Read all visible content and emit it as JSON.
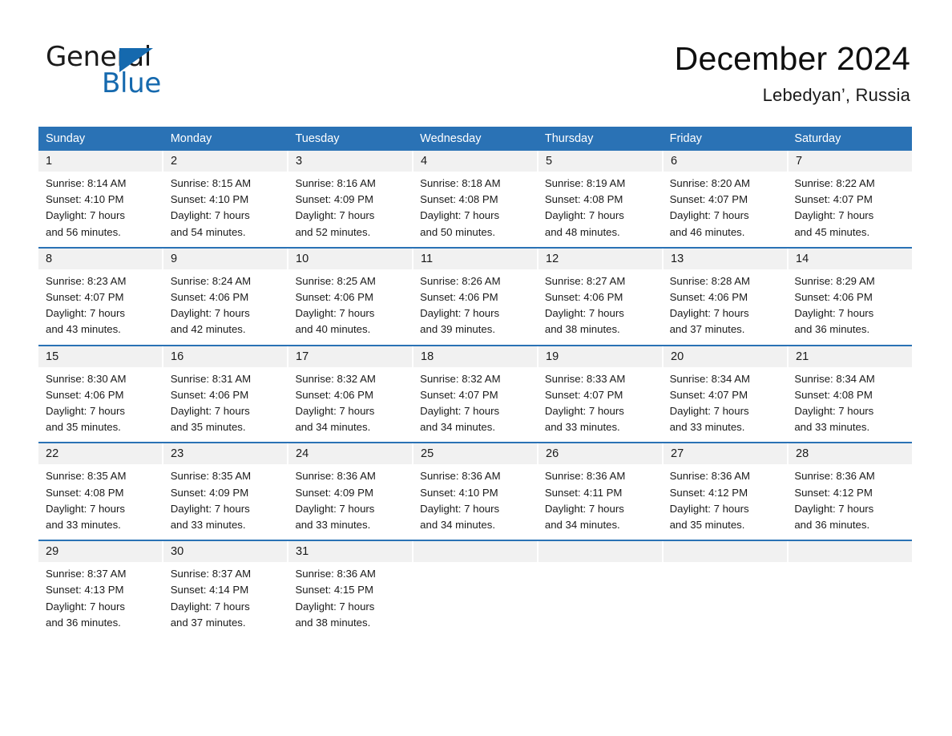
{
  "brand": {
    "name_part1": "General",
    "name_part2": "Blue",
    "triangle_color": "#1569ae"
  },
  "header": {
    "title": "December 2024",
    "subtitle": "Lebedyan’, Russia",
    "accent_color": "#2a72b5"
  },
  "weekdays": [
    "Sunday",
    "Monday",
    "Tuesday",
    "Wednesday",
    "Thursday",
    "Friday",
    "Saturday"
  ],
  "weeks": [
    {
      "days": [
        {
          "date": "1",
          "lines": [
            "Sunrise: 8:14 AM",
            "Sunset: 4:10 PM",
            "Daylight: 7 hours",
            "and 56 minutes."
          ]
        },
        {
          "date": "2",
          "lines": [
            "Sunrise: 8:15 AM",
            "Sunset: 4:10 PM",
            "Daylight: 7 hours",
            "and 54 minutes."
          ]
        },
        {
          "date": "3",
          "lines": [
            "Sunrise: 8:16 AM",
            "Sunset: 4:09 PM",
            "Daylight: 7 hours",
            "and 52 minutes."
          ]
        },
        {
          "date": "4",
          "lines": [
            "Sunrise: 8:18 AM",
            "Sunset: 4:08 PM",
            "Daylight: 7 hours",
            "and 50 minutes."
          ]
        },
        {
          "date": "5",
          "lines": [
            "Sunrise: 8:19 AM",
            "Sunset: 4:08 PM",
            "Daylight: 7 hours",
            "and 48 minutes."
          ]
        },
        {
          "date": "6",
          "lines": [
            "Sunrise: 8:20 AM",
            "Sunset: 4:07 PM",
            "Daylight: 7 hours",
            "and 46 minutes."
          ]
        },
        {
          "date": "7",
          "lines": [
            "Sunrise: 8:22 AM",
            "Sunset: 4:07 PM",
            "Daylight: 7 hours",
            "and 45 minutes."
          ]
        }
      ]
    },
    {
      "days": [
        {
          "date": "8",
          "lines": [
            "Sunrise: 8:23 AM",
            "Sunset: 4:07 PM",
            "Daylight: 7 hours",
            "and 43 minutes."
          ]
        },
        {
          "date": "9",
          "lines": [
            "Sunrise: 8:24 AM",
            "Sunset: 4:06 PM",
            "Daylight: 7 hours",
            "and 42 minutes."
          ]
        },
        {
          "date": "10",
          "lines": [
            "Sunrise: 8:25 AM",
            "Sunset: 4:06 PM",
            "Daylight: 7 hours",
            "and 40 minutes."
          ]
        },
        {
          "date": "11",
          "lines": [
            "Sunrise: 8:26 AM",
            "Sunset: 4:06 PM",
            "Daylight: 7 hours",
            "and 39 minutes."
          ]
        },
        {
          "date": "12",
          "lines": [
            "Sunrise: 8:27 AM",
            "Sunset: 4:06 PM",
            "Daylight: 7 hours",
            "and 38 minutes."
          ]
        },
        {
          "date": "13",
          "lines": [
            "Sunrise: 8:28 AM",
            "Sunset: 4:06 PM",
            "Daylight: 7 hours",
            "and 37 minutes."
          ]
        },
        {
          "date": "14",
          "lines": [
            "Sunrise: 8:29 AM",
            "Sunset: 4:06 PM",
            "Daylight: 7 hours",
            "and 36 minutes."
          ]
        }
      ]
    },
    {
      "days": [
        {
          "date": "15",
          "lines": [
            "Sunrise: 8:30 AM",
            "Sunset: 4:06 PM",
            "Daylight: 7 hours",
            "and 35 minutes."
          ]
        },
        {
          "date": "16",
          "lines": [
            "Sunrise: 8:31 AM",
            "Sunset: 4:06 PM",
            "Daylight: 7 hours",
            "and 35 minutes."
          ]
        },
        {
          "date": "17",
          "lines": [
            "Sunrise: 8:32 AM",
            "Sunset: 4:06 PM",
            "Daylight: 7 hours",
            "and 34 minutes."
          ]
        },
        {
          "date": "18",
          "lines": [
            "Sunrise: 8:32 AM",
            "Sunset: 4:07 PM",
            "Daylight: 7 hours",
            "and 34 minutes."
          ]
        },
        {
          "date": "19",
          "lines": [
            "Sunrise: 8:33 AM",
            "Sunset: 4:07 PM",
            "Daylight: 7 hours",
            "and 33 minutes."
          ]
        },
        {
          "date": "20",
          "lines": [
            "Sunrise: 8:34 AM",
            "Sunset: 4:07 PM",
            "Daylight: 7 hours",
            "and 33 minutes."
          ]
        },
        {
          "date": "21",
          "lines": [
            "Sunrise: 8:34 AM",
            "Sunset: 4:08 PM",
            "Daylight: 7 hours",
            "and 33 minutes."
          ]
        }
      ]
    },
    {
      "days": [
        {
          "date": "22",
          "lines": [
            "Sunrise: 8:35 AM",
            "Sunset: 4:08 PM",
            "Daylight: 7 hours",
            "and 33 minutes."
          ]
        },
        {
          "date": "23",
          "lines": [
            "Sunrise: 8:35 AM",
            "Sunset: 4:09 PM",
            "Daylight: 7 hours",
            "and 33 minutes."
          ]
        },
        {
          "date": "24",
          "lines": [
            "Sunrise: 8:36 AM",
            "Sunset: 4:09 PM",
            "Daylight: 7 hours",
            "and 33 minutes."
          ]
        },
        {
          "date": "25",
          "lines": [
            "Sunrise: 8:36 AM",
            "Sunset: 4:10 PM",
            "Daylight: 7 hours",
            "and 34 minutes."
          ]
        },
        {
          "date": "26",
          "lines": [
            "Sunrise: 8:36 AM",
            "Sunset: 4:11 PM",
            "Daylight: 7 hours",
            "and 34 minutes."
          ]
        },
        {
          "date": "27",
          "lines": [
            "Sunrise: 8:36 AM",
            "Sunset: 4:12 PM",
            "Daylight: 7 hours",
            "and 35 minutes."
          ]
        },
        {
          "date": "28",
          "lines": [
            "Sunrise: 8:36 AM",
            "Sunset: 4:12 PM",
            "Daylight: 7 hours",
            "and 36 minutes."
          ]
        }
      ]
    },
    {
      "days": [
        {
          "date": "29",
          "lines": [
            "Sunrise: 8:37 AM",
            "Sunset: 4:13 PM",
            "Daylight: 7 hours",
            "and 36 minutes."
          ]
        },
        {
          "date": "30",
          "lines": [
            "Sunrise: 8:37 AM",
            "Sunset: 4:14 PM",
            "Daylight: 7 hours",
            "and 37 minutes."
          ]
        },
        {
          "date": "31",
          "lines": [
            "Sunrise: 8:36 AM",
            "Sunset: 4:15 PM",
            "Daylight: 7 hours",
            "and 38 minutes."
          ]
        },
        {
          "date": "",
          "lines": []
        },
        {
          "date": "",
          "lines": []
        },
        {
          "date": "",
          "lines": []
        },
        {
          "date": "",
          "lines": []
        }
      ]
    }
  ]
}
